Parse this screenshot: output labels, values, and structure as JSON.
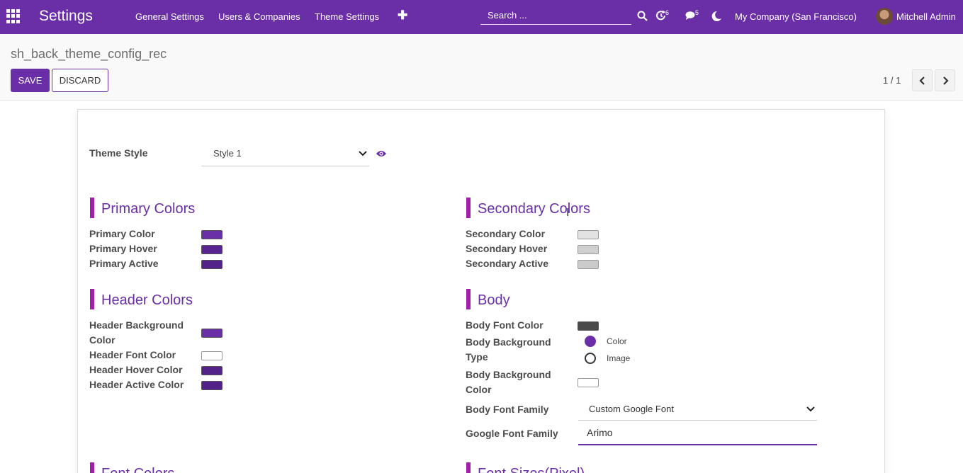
{
  "navbar": {
    "app_title": "Settings",
    "menu": [
      "General Settings",
      "Users & Companies",
      "Theme Settings"
    ],
    "add_icon": "plus-icon",
    "search_placeholder": "Search ...",
    "activity_count": "6",
    "messages_count": "5",
    "company": "My Company (San Francisco)",
    "user": "Mitchell Admin",
    "color": "#6a2fa6"
  },
  "control": {
    "breadcrumb": "sh_back_theme_config_rec",
    "save_label": "SAVE",
    "discard_label": "DISCARD",
    "pager": "1 / 1"
  },
  "form": {
    "theme_style": {
      "label": "Theme Style",
      "value": "Style 1"
    },
    "primary": {
      "title": "Primary Colors",
      "fields": [
        {
          "label": "Primary Color",
          "color": "#6a2fa6"
        },
        {
          "label": "Primary Hover",
          "color": "#5a2590"
        },
        {
          "label": "Primary Active",
          "color": "#54238a"
        }
      ]
    },
    "secondary": {
      "title": "Secondary Colors",
      "fields": [
        {
          "label": "Secondary Color",
          "color": "#e2e2e2"
        },
        {
          "label": "Secondary Hover",
          "color": "#d0d0d0"
        },
        {
          "label": "Secondary Active",
          "color": "#cbcbcb"
        }
      ]
    },
    "header": {
      "title": "Header Colors",
      "fields": [
        {
          "label_line1": "Header Background",
          "label_line2": "Color",
          "color": "#6a2fa6"
        },
        {
          "label": "Header Font Color",
          "color": "#ffffff"
        },
        {
          "label": "Header Hover Color",
          "color": "#54238a"
        },
        {
          "label": "Header Active Color",
          "color": "#54238a"
        }
      ]
    },
    "body": {
      "title": "Body",
      "font_color": {
        "label": "Body Font Color",
        "color": "#4a4a4a"
      },
      "bg_type": {
        "label_line1": "Body Background",
        "label_line2": "Type",
        "options": [
          "Color",
          "Image"
        ],
        "selected": "Color"
      },
      "bg_color": {
        "label_line1": "Body Background",
        "label_line2": "Color",
        "color": "#ffffff"
      },
      "font_family": {
        "label": "Body Font Family",
        "value": "Custom Google Font"
      },
      "google_font": {
        "label": "Google Font Family",
        "value": "Arimo"
      }
    },
    "font_colors": {
      "title": "Font Colors"
    },
    "font_sizes": {
      "title": "Font Sizes(Pixel)"
    }
  }
}
